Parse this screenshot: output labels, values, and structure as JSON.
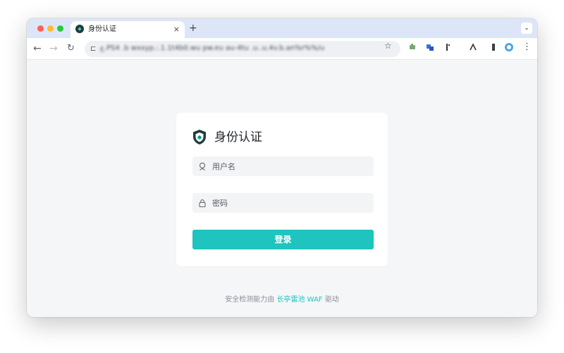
{
  "browser": {
    "tab_title": "身份认证",
    "tab_close": "×",
    "new_tab": "+",
    "tab_search": "⌄",
    "back": "←",
    "forward": "→",
    "reload": "↻",
    "site_info": "⊏",
    "url": "ع.PS4 .b wxxyp.:.1.1t4b0.wu pw.eu au-4tu .u..u.4v.b.an%r%%/u",
    "bookmark": "☆",
    "menu": "⋮",
    "extensions": [
      "puzzle-extension-icon",
      "translate-extension-icon",
      "cursor-extension-icon",
      "text-extension-icon",
      "sidepanel-extension-icon",
      "profile-extension-icon"
    ]
  },
  "login": {
    "title": "身份认证",
    "username_placeholder": "用户名",
    "password_placeholder": "密码",
    "submit_label": "登录"
  },
  "footer": {
    "prefix": "安全检测能力由",
    "link": "长亭雷池 WAF",
    "suffix": "驱动"
  },
  "colors": {
    "accent": "#1ec4bd",
    "shield_dark": "#1f3b3a",
    "page_bg": "#f5f6f8"
  }
}
